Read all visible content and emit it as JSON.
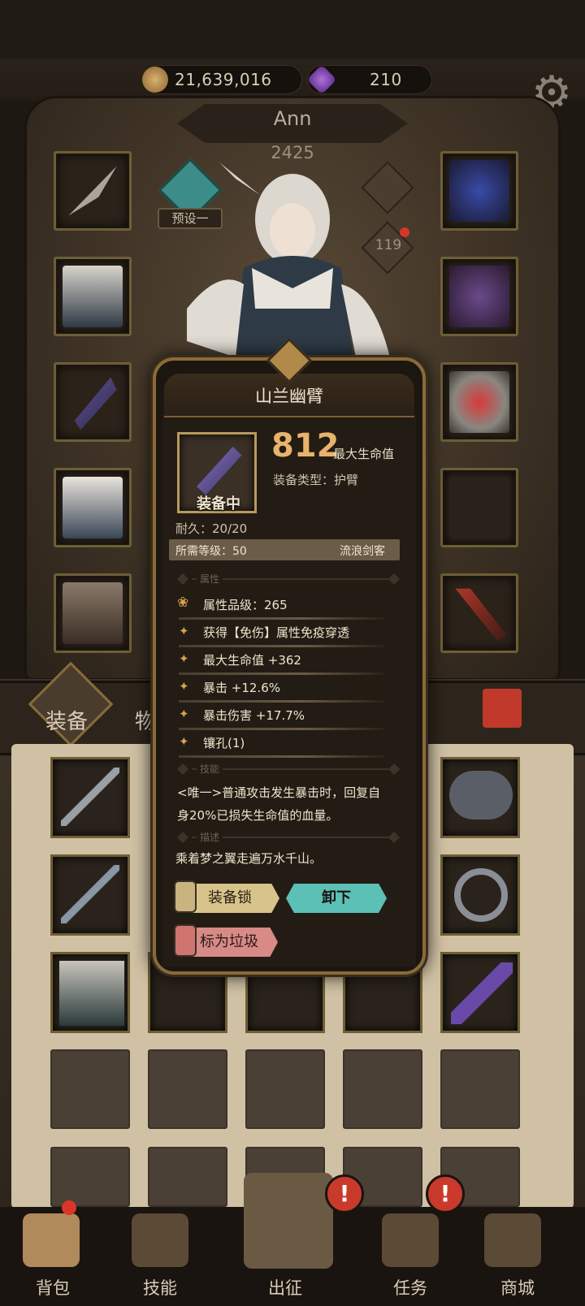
{
  "resources": {
    "gold": "21,639,016",
    "gems": "210"
  },
  "character": {
    "name": "Ann",
    "power": "2425",
    "preset_label": "预设一",
    "level": "119"
  },
  "inventory_tabs": {
    "equipment": "装备",
    "items": "物品"
  },
  "popup": {
    "title": "山兰幽臂",
    "equipped_label": "装备中",
    "main_value": "812",
    "main_unit": "最大生命值",
    "type_label": "装备类型：护臂",
    "durability": "耐久：20/20",
    "required_level": "所需等级：50",
    "class_name": "流浪剑客",
    "section_attributes": "属性",
    "attr_grade": "属性品级：265",
    "attributes": [
      "获得【免伤】属性免疫穿透",
      "最大生命值 +362",
      "暴击 +12.6%",
      "暴击伤害 +17.7%",
      "镶孔(1)"
    ],
    "section_skill": "技能",
    "skill_line1": "<唯一>普通攻击发生暴击时，回复自",
    "skill_line2": "身20%已损失生命值的血量。",
    "section_desc": "描述",
    "description": "乘着梦之翼走遍万水千山。",
    "btn_lock": "装备锁",
    "btn_unequip": "卸下",
    "btn_trash": "标为垃圾"
  },
  "bottom_nav": {
    "bag": "背包",
    "skills": "技能",
    "expedition": "出征",
    "tasks": "任务",
    "shop": "商城"
  },
  "alert_glyph": "!",
  "icons": {
    "gear": "gear-icon",
    "gold": "coin-icon",
    "gem": "gem-icon",
    "trash": "trash-icon"
  },
  "colors": {
    "gold_text": "#e8b36a",
    "teal_button": "#5cc0b6",
    "alert_red": "#c93a2c"
  }
}
